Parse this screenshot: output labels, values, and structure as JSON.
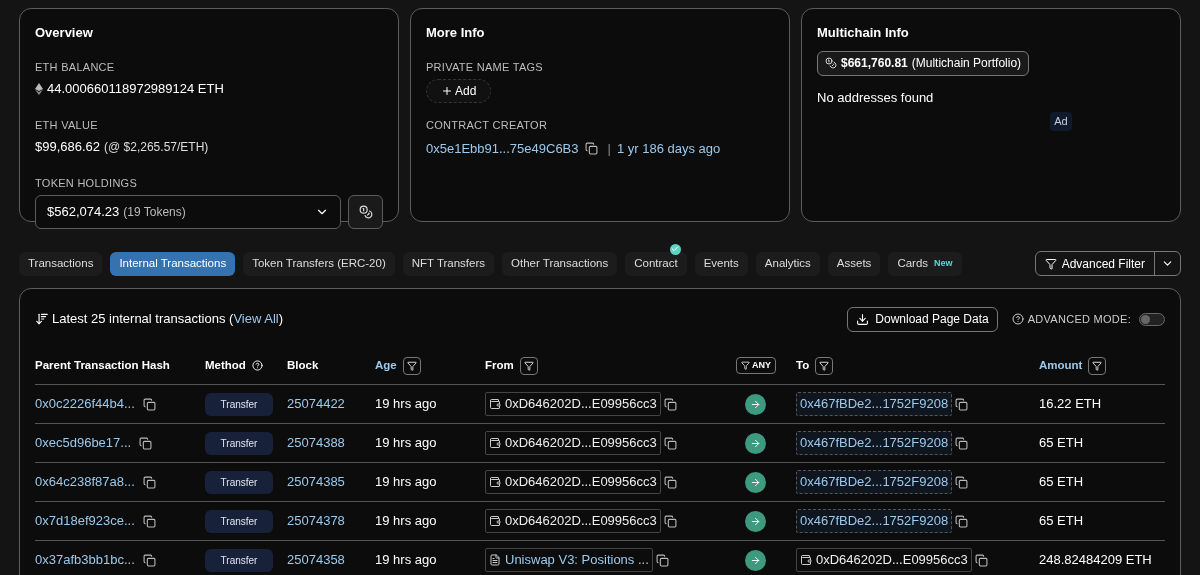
{
  "overview": {
    "title": "Overview",
    "eth_balance": {
      "label": "ETH BALANCE",
      "value": "44.000660118972989124 ETH"
    },
    "eth_value": {
      "label": "ETH VALUE",
      "value": "$99,686.62",
      "rate": "(@ $2,265.57/ETH)"
    },
    "token_holdings": {
      "label": "TOKEN HOLDINGS",
      "value": "$562,074.23",
      "count": "(19 Tokens)"
    }
  },
  "more_info": {
    "title": "More Info",
    "private_name_tags": {
      "label": "PRIVATE NAME TAGS",
      "button": "Add"
    },
    "contract_creator": {
      "label": "CONTRACT CREATOR",
      "address": "0x5e1Ebb91...75e49C6B3",
      "separator": "|",
      "age": "1 yr 186 days ago"
    }
  },
  "multichain_info": {
    "title": "Multichain Info",
    "portfolio_value": "$661,760.81",
    "portfolio_label": "(Multichain Portfolio)",
    "message": "No addresses found",
    "ad": "Ad"
  },
  "tabs": [
    {
      "label": "Transactions",
      "selected": false,
      "verified": false
    },
    {
      "label": "Internal Transactions",
      "selected": true,
      "verified": false
    },
    {
      "label": "Token Transfers (ERC-20)",
      "selected": false,
      "verified": false
    },
    {
      "label": "NFT Transfers",
      "selected": false,
      "verified": false
    },
    {
      "label": "Other Transactions",
      "selected": false,
      "verified": false
    },
    {
      "label": "Contract",
      "selected": false,
      "verified": true
    },
    {
      "label": "Events",
      "selected": false,
      "verified": false
    },
    {
      "label": "Analytics",
      "selected": false,
      "verified": false
    },
    {
      "label": "Assets",
      "selected": false,
      "verified": false
    },
    {
      "label": "Cards",
      "selected": false,
      "verified": false,
      "badge": "New"
    }
  ],
  "advanced_filter": {
    "label": "Advanced Filter"
  },
  "table": {
    "summary": "Latest 25 internal transactions (",
    "view_all": "View All",
    "summary_end": ")",
    "download": "Download Page Data",
    "advanced_mode": {
      "label": "ADVANCED MODE:",
      "on": false
    },
    "columns": [
      {
        "label": "Parent Transaction Hash",
        "kind": "plain",
        "sortable": false
      },
      {
        "label": "Method",
        "kind": "help",
        "sortable": false
      },
      {
        "label": "Block",
        "kind": "plain",
        "sortable": false
      },
      {
        "label": "Age",
        "kind": "filter",
        "sortable": true
      },
      {
        "label": "From",
        "kind": "filter",
        "sortable": false
      },
      {
        "label": "ANY",
        "kind": "direction"
      },
      {
        "label": "To",
        "kind": "filter",
        "sortable": false
      },
      {
        "label": "Amount",
        "kind": "filter",
        "sortable": true
      }
    ],
    "rows": [
      {
        "hash": "0x0c2226f44b4...",
        "method": "Transfer",
        "block": "25074422",
        "age": "19 hrs ago",
        "from": {
          "kind": "wallet",
          "text": "0xD646202D...E09956cc3"
        },
        "to": {
          "kind": "address",
          "text": "0x467fBDe2...1752F9208"
        },
        "amount": "16.22 ETH"
      },
      {
        "hash": "0xec5d96be17...",
        "method": "Transfer",
        "block": "25074388",
        "age": "19 hrs ago",
        "from": {
          "kind": "wallet",
          "text": "0xD646202D...E09956cc3"
        },
        "to": {
          "kind": "address",
          "text": "0x467fBDe2...1752F9208"
        },
        "amount": "65 ETH"
      },
      {
        "hash": "0x64c238f87a8...",
        "method": "Transfer",
        "block": "25074385",
        "age": "19 hrs ago",
        "from": {
          "kind": "wallet",
          "text": "0xD646202D...E09956cc3"
        },
        "to": {
          "kind": "address",
          "text": "0x467fBDe2...1752F9208"
        },
        "amount": "65 ETH"
      },
      {
        "hash": "0x7d18ef923ce...",
        "method": "Transfer",
        "block": "25074378",
        "age": "19 hrs ago",
        "from": {
          "kind": "wallet",
          "text": "0xD646202D...E09956cc3"
        },
        "to": {
          "kind": "address",
          "text": "0x467fBDe2...1752F9208"
        },
        "amount": "65 ETH"
      },
      {
        "hash": "0x37afb3bb1bc...",
        "method": "Transfer",
        "block": "25074358",
        "age": "19 hrs ago",
        "from": {
          "kind": "contract",
          "text": "Uniswap V3: Positions ..."
        },
        "to": {
          "kind": "wallet",
          "text": "0xD646202D...E09956cc3"
        },
        "amount": "248.82484209 ETH"
      }
    ]
  }
}
